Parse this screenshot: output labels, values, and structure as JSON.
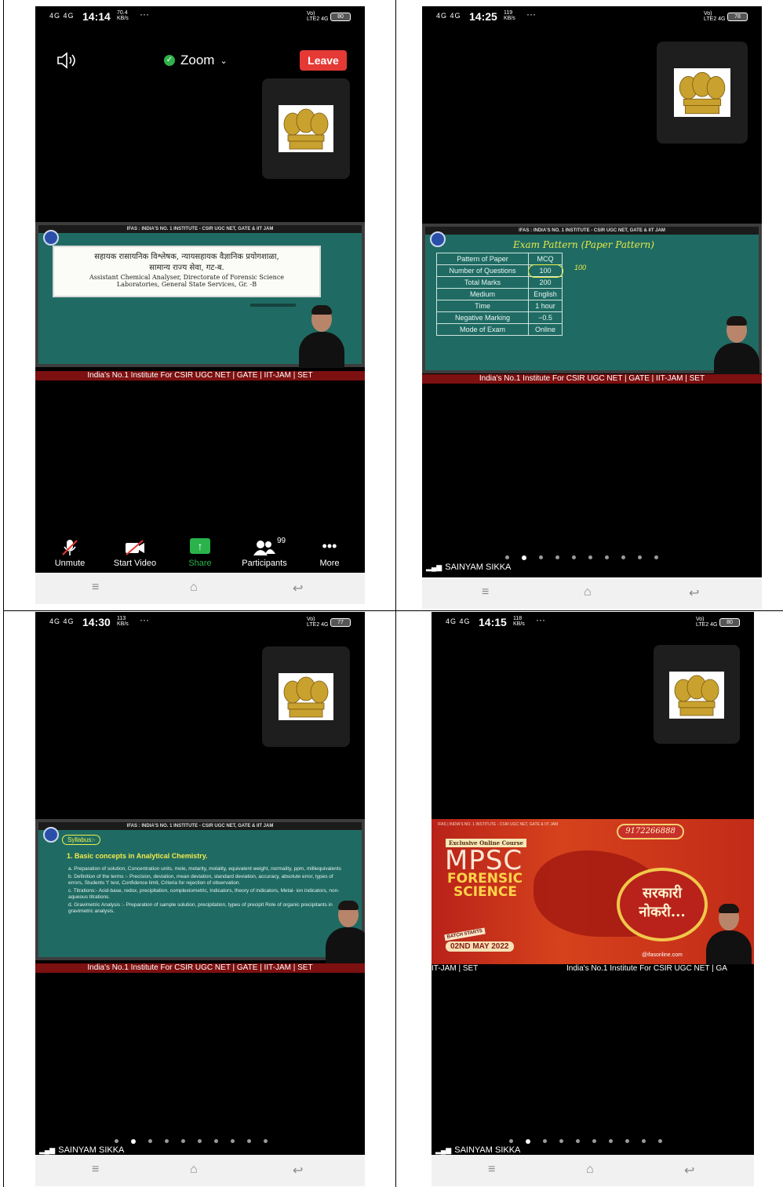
{
  "panels": {
    "p1": {
      "status": {
        "signal": "4G 4G",
        "time": "14:14",
        "rate": "70.4 KB/s",
        "dots": "···",
        "net": "Vo) LTE2 4G",
        "battery": "80"
      },
      "speaker_icon": "speaker-icon",
      "meeting_title": "Zoom",
      "leave_label": "Leave",
      "slide_header": "IFAS : INDIA'S NO. 1 INSTITUTE - CSIR UGC NET, GATE & IIT JAM",
      "slide_line1": "सहायक रासायनिक विश्लेषक, न्यायसहायक वैज्ञानिक प्रयोगशाळा,",
      "slide_line2": "सामान्य राज्य सेवा, गट-ब.",
      "slide_line3": "Assistant Chemical Analyser, Directorate of Forensic Science",
      "slide_line4": "Laboratories, General State Services, Gr. -B",
      "ticker": "India's No.1 Institute For CSIR UGC NET | GATE | IIT-JAM | SET",
      "toolbar": {
        "unmute": "Unmute",
        "start_video": "Start Video",
        "share": "Share",
        "participants": "Participants",
        "participants_count": "99",
        "more": "More"
      }
    },
    "p2": {
      "status": {
        "signal": "4G 4G",
        "time": "14:25",
        "rate": "119 KB/s",
        "dots": "···",
        "net": "Vo) LTE2 4G",
        "battery": "78"
      },
      "slide_header": "IFAS : INDIA'S NO. 1 INSTITUTE - CSIR UGC NET, GATE & IIT JAM",
      "handwriting": "Exam Pattern (Paper Pattern)",
      "table": [
        [
          "Pattern of Paper",
          "MCQ"
        ],
        [
          "Number of Questions",
          "100"
        ],
        [
          "Total Marks",
          "200"
        ],
        [
          "Medium",
          "English"
        ],
        [
          "Time",
          "1 hour"
        ],
        [
          "Negative Marking",
          "−0.5"
        ],
        [
          "Mode of Exam",
          "Online"
        ]
      ],
      "handwriting_note": "100",
      "ticker": "India's No.1 Institute For CSIR UGC NET | GATE | IIT-JAM | SET",
      "speaker": "SAINYAM SIKKA"
    },
    "p3": {
      "status": {
        "signal": "4G 4G",
        "time": "14:30",
        "rate": "113 KB/s",
        "dots": "···",
        "net": "Vo) LTE2 4G",
        "battery": "77"
      },
      "slide_header": "IFAS : INDIA'S NO. 1 INSTITUTE - CSIR UGC NET, GATE & IIT JAM",
      "syllabus_tag": "Syllabus:-",
      "heading": "1. Basic concepts in Analytical Chemistry.",
      "item_a": "a. Preparation of solution, Concentration units, mole, molarity, molality, equivalent weight, normality, ppm, milliequivalents",
      "item_b": "b. Definition of the terms :- Precision, deviation, mean deviation, standard deviation, accuracy, absolute error, types of errors, Students 't' test, Confidence limit, Criteria for rejection of observation.",
      "item_c": "c. Titrations:- Acid-base, redox, precipitation, complexiometric, Indicators, theory of indicators, Metal- ion indicators, non-aqueous titrations.",
      "item_d": "d. Gravimetric Analysis :- Preparation of sample solution, precipitation, types of precipit Role of organic precipitants in gravimetric analysis.",
      "ticker": "India's No.1 Institute For CSIR UGC NET | GATE | IIT-JAM | SET",
      "speaker": "SAINYAM SIKKA"
    },
    "p4": {
      "status": {
        "signal": "4G 4G",
        "time": "14:15",
        "rate": "118 KB/s",
        "dots": "···",
        "net": "Vo) LTE2 4G",
        "battery": "80"
      },
      "slide_header": "IFAS | INDIA'S NO. 1 INSTITUTE - CSIR UGC NET, GATE & IIT JAM",
      "phone": "9172266888",
      "course_tag": "Exclusive Online Course",
      "mpsc": "MPSC",
      "forensic": "FORENSIC",
      "science": "SCIENCE",
      "sarkari": "सरकारी",
      "naukari": "नोकरी...",
      "batch_label": "BATCH STARTS",
      "batch_date": "02ND MAY 2022",
      "website": "@ifasonline.com",
      "ticker_left": "IT-JAM | SET",
      "ticker_right": "India's No.1 Institute For CSIR UGC NET | GA",
      "speaker": "SAINYAM SIKKA"
    }
  },
  "colors": {
    "leave": "#e53935",
    "share": "#29b34a",
    "slide": "#1f6b63",
    "ticker": "#7d1010",
    "promo": "#c9301c"
  }
}
